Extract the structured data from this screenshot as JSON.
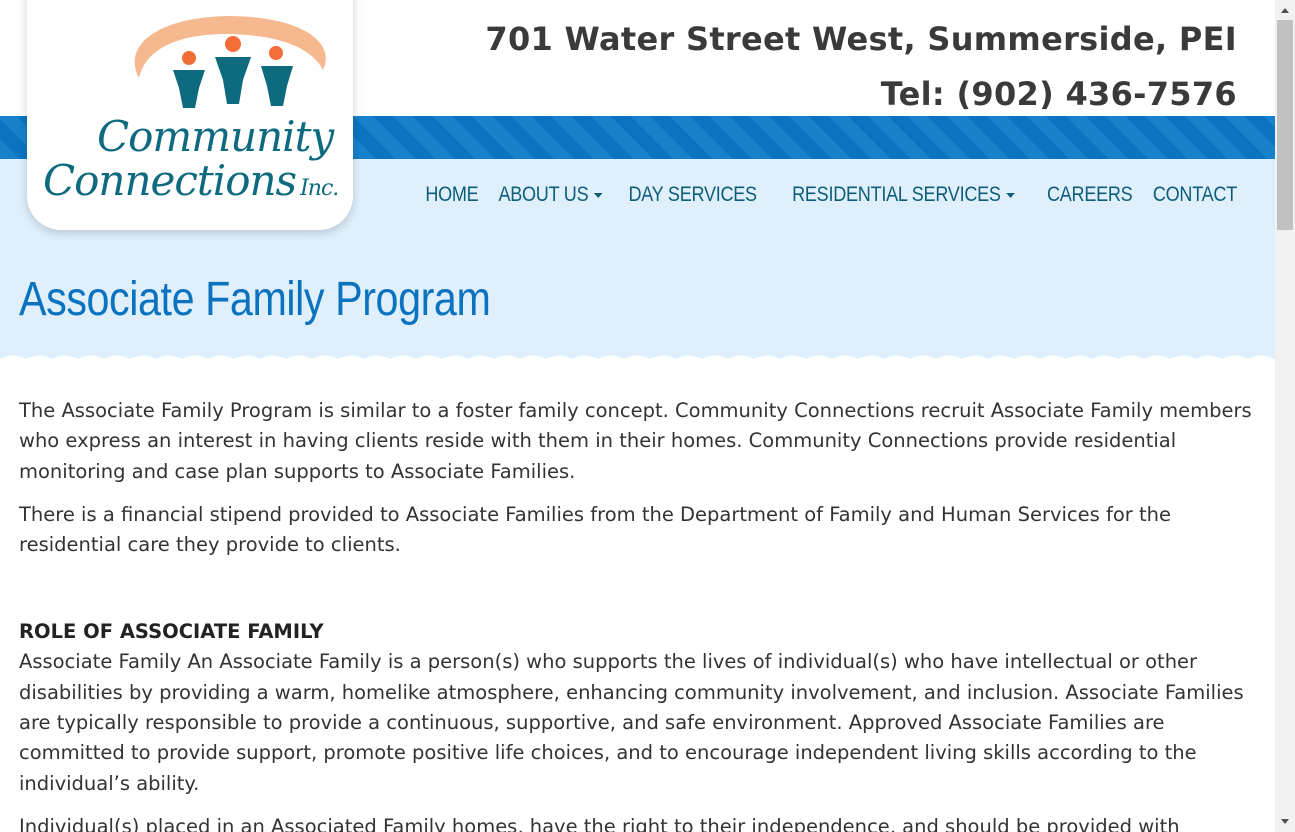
{
  "header": {
    "address": "701 Water Street West, Summerside, PEI",
    "phone": "Tel: (902) 436-7576"
  },
  "logo": {
    "line1": "Community",
    "line2": "Connections",
    "suffix": "Inc."
  },
  "nav": {
    "items": [
      {
        "label": "HOME",
        "dropdown": false
      },
      {
        "label": "ABOUT US",
        "dropdown": true
      },
      {
        "label": "DAY SERVICES",
        "dropdown": false
      },
      {
        "label": "RESIDENTIAL SERVICES",
        "dropdown": true
      },
      {
        "label": "CAREERS",
        "dropdown": false
      },
      {
        "label": "CONTACT",
        "dropdown": false
      }
    ]
  },
  "page": {
    "title": "Associate Family Program"
  },
  "content": {
    "p1": "The Associate Family Program is similar to a foster family concept. Community Connections recruit Associate Family members who express an interest in having clients reside with them in their homes. Community Connections provide residential monitoring and case plan supports to Associate Families.",
    "p2": "There is a financial stipend provided to Associate Families from the Department of Family and Human Services for the residential care they provide to clients.",
    "heading": "ROLE OF ASSOCIATE FAMILY",
    "p3": "Associate Family An Associate Family is a person(s) who supports the lives of individual(s) who have intellectual or other disabilities by providing a warm, homelike atmosphere, enhancing community involvement, and inclusion. Associate Families are typically responsible to provide a continuous, supportive, and safe environment. Approved Associate Families are committed to provide support, promote positive life choices, and to encourage independent living skills according to the individual’s ability.",
    "p4": "Individual(s) placed in an Associated Family homes, have the right to their independence, and should be provided with"
  },
  "colors": {
    "accent": "#0b72c0",
    "nav_text": "#0d5d78",
    "stripe": "#0a79c9",
    "hero_bg": "#dff0fc",
    "logo_teal": "#0e6a7e",
    "logo_orange": "#f26d38",
    "logo_arc": "#f6b98f"
  }
}
